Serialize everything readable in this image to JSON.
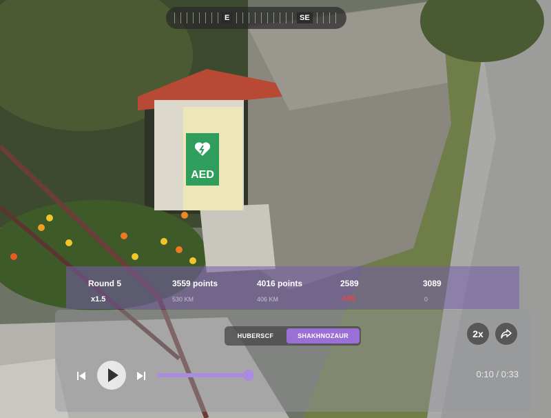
{
  "compass": {
    "labels": [
      "E",
      "SE"
    ]
  },
  "sign": {
    "label": "AED"
  },
  "scoreboard": {
    "round_label": "Round 5",
    "multiplier": "x1.5",
    "p1_points": "3559 points",
    "p1_distance": "530 KM",
    "p2_points": "4016 points",
    "p2_distance": "406 KM",
    "p1_total": "2589",
    "p1_delta": "-686",
    "p2_total": "3089",
    "p2_delta": "0",
    "colors": {
      "accent": "#9a6fd6",
      "negative": "#e0484d"
    }
  },
  "player": {
    "tabs": [
      {
        "label": "HUBERSCF",
        "active": false
      },
      {
        "label": "SHAKHNOZAUR",
        "active": true
      }
    ],
    "speed_label": "2x",
    "share_icon": "share-icon",
    "prev_icon": "skip-back-icon",
    "play_icon": "play-icon",
    "next_icon": "skip-forward-icon",
    "progress": 0.3,
    "time_text": "0:10 / 0:33"
  }
}
